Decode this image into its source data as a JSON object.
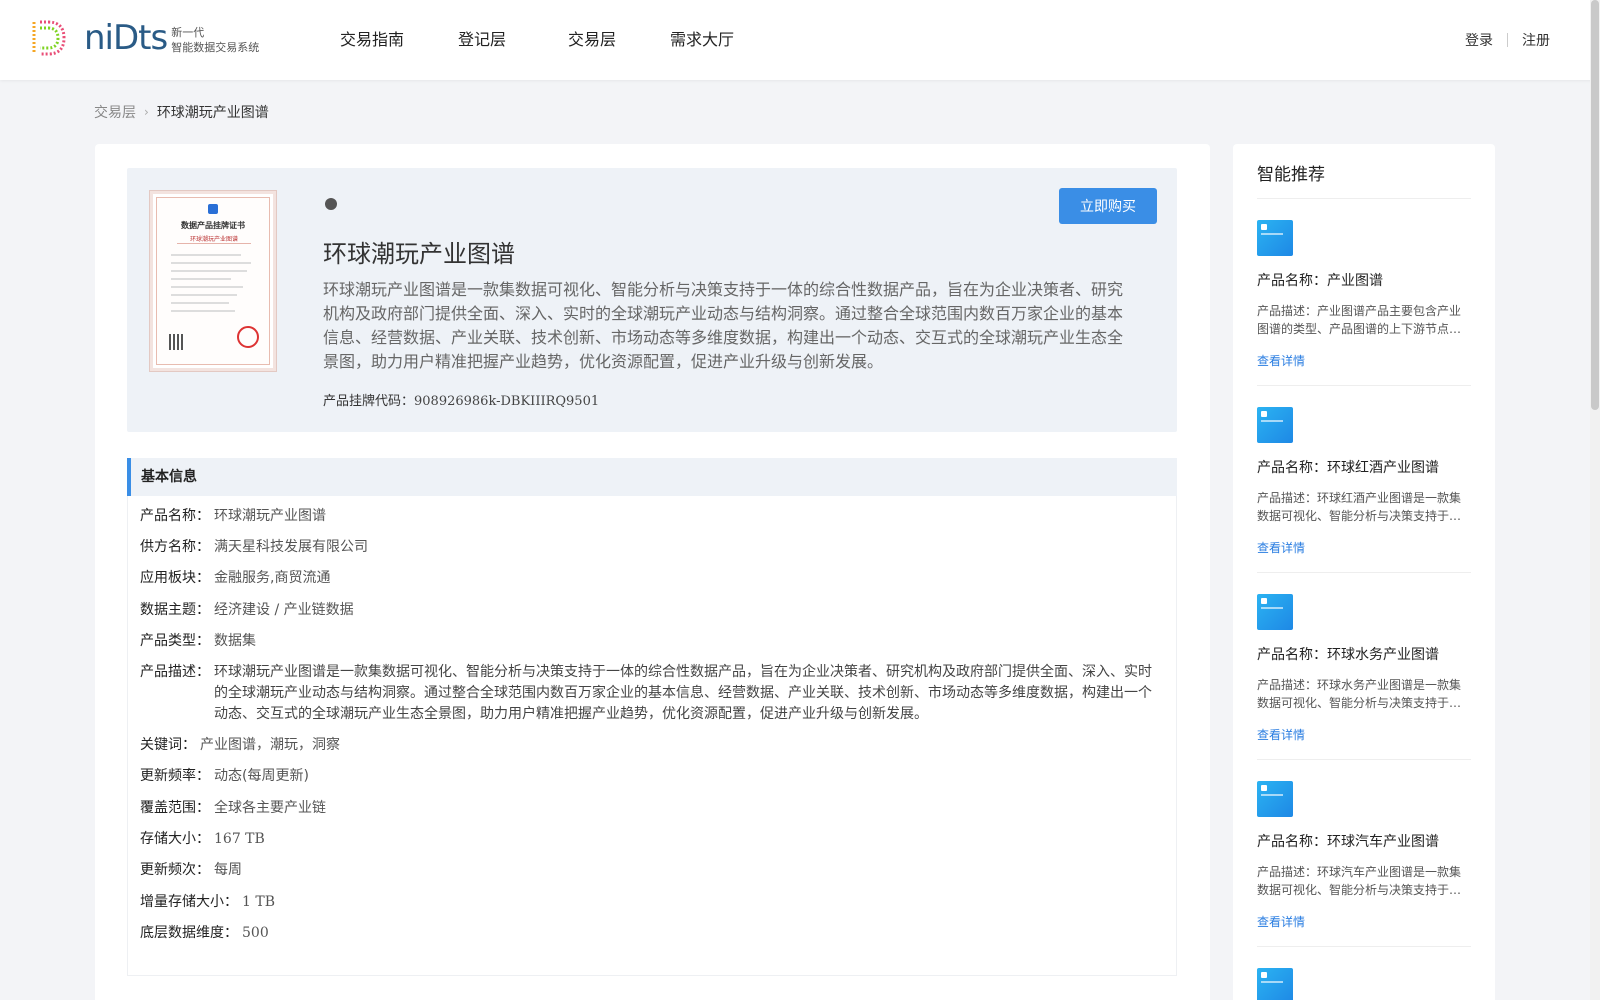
{
  "header": {
    "logo_word": "niDts",
    "logo_sub_1": "新一代",
    "logo_sub_2": "智能数据交易系统",
    "nav": [
      "交易指南",
      "登记层",
      "交易层",
      "需求大厅"
    ],
    "login": "登录",
    "register": "注册"
  },
  "breadcrumb": {
    "parent": "交易层",
    "current": "环球潮玩产业图谱"
  },
  "product": {
    "title": "环球潮玩产业图谱",
    "description": "环球潮玩产业图谱是一款集数据可视化、智能分析与决策支持于一体的综合性数据产品，旨在为企业决策者、研究机构及政府部门提供全面、深入、实时的全球潮玩产业动态与结构洞察。通过整合全球范围内数百万家企业的基本信息、经营数据、产业关联、技术创新、市场动态等多维度数据，构建出一个动态、交互式的全球潮玩产业生态全景图，助力用户精准把握产业趋势，优化资源配置，促进产业升级与创新发展。",
    "code_label": "产品挂牌代码：",
    "code_value": "908926986k-DBKIIIRQ9501",
    "buy_label": "立即购买",
    "cert_title": "数据产品挂牌证书",
    "cert_sub": "环球潮玩产业图谱"
  },
  "basic_info": {
    "heading": "基本信息",
    "rows": [
      {
        "k": "产品名称：",
        "v": "环球潮玩产业图谱"
      },
      {
        "k": "供方名称：",
        "v": "满天星科技发展有限公司"
      },
      {
        "k": "应用板块：",
        "v": "金融服务,商贸流通"
      },
      {
        "k": "数据主题：",
        "v": "经济建设 / 产业链数据"
      },
      {
        "k": "产品类型：",
        "v": "数据集"
      },
      {
        "k": "产品描述：",
        "v": "环球潮玩产业图谱是一款集数据可视化、智能分析与决策支持于一体的综合性数据产品，旨在为企业决策者、研究机构及政府部门提供全面、深入、实时的全球潮玩产业动态与结构洞察。通过整合全球范围内数百万家企业的基本信息、经营数据、产业关联、技术创新、市场动态等多维度数据，构建出一个动态、交互式的全球潮玩产业生态全景图，助力用户精准把握产业趋势，优化资源配置，促进产业升级与创新发展。"
      },
      {
        "k": "关键词：",
        "v": "产业图谱，潮玩，洞察"
      },
      {
        "k": "更新频率：",
        "v": "动态(每周更新)"
      },
      {
        "k": "覆盖范围：",
        "v": "全球各主要产业链"
      },
      {
        "k": "存储大小：",
        "v": "167 TB"
      },
      {
        "k": "更新频次：",
        "v": "每周"
      },
      {
        "k": "增量存储大小：",
        "v": "1 TB"
      },
      {
        "k": "底层数据维度：",
        "v": "500"
      }
    ]
  },
  "sidebar": {
    "title": "智能推荐",
    "link_label": "查看详情",
    "items": [
      {
        "name": "产品名称：产业图谱",
        "desc": "产品描述：产业图谱产品主要包含产业图谱的类型、产品图谱的上下游节点及关联关系等信息"
      },
      {
        "name": "产品名称：环球红酒产业图谱",
        "desc": "产品描述：环球红酒产业图谱是一款集数据可视化、智能分析与决策支持于一体的综合性数据产品"
      },
      {
        "name": "产品名称：环球水务产业图谱",
        "desc": "产品描述：环球水务产业图谱是一款集数据可视化、智能分析与决策支持于一体的综合性数据产品"
      },
      {
        "name": "产品名称：环球汽车产业图谱",
        "desc": "产品描述：环球汽车产业图谱是一款集数据可视化、智能分析与决策支持于一体的综合性数据产品"
      }
    ]
  },
  "colors": {
    "accent": "#3a8ee6",
    "link": "#2a7de1",
    "hero_bg": "#eef2f7"
  }
}
